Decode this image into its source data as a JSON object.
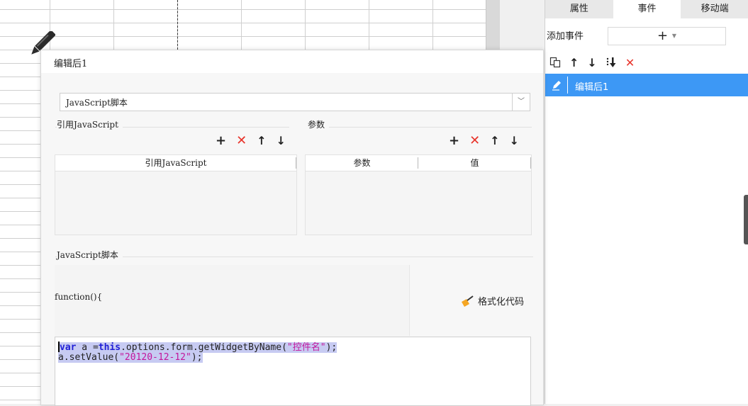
{
  "right_panel": {
    "tabs": [
      "属性",
      "事件",
      "移动端"
    ],
    "active_tab": 1,
    "add_event_label": "添加事件",
    "add_event_button": "+",
    "selected_event": "编辑后1"
  },
  "dialog": {
    "title": "编辑后1",
    "type_select": "JavaScript脚本",
    "ref_js_section": "引用JavaScript",
    "ref_js_column": "引用JavaScript",
    "params_section": "参数",
    "params_columns": [
      "参数",
      "值"
    ],
    "script_section": "JavaScript脚本",
    "function_header": "function(){",
    "format_button": "格式化代码",
    "code": {
      "line1_kw1": "var",
      "line1_mid": " a =",
      "line1_kw2": "this",
      "line1_rest": ".options.form.getWidgetByName(",
      "line1_str": "\"控件名\"",
      "line1_end": ");",
      "line2_start": "a.setValue(",
      "line2_str": "\"20120-12-12\"",
      "line2_end": ");"
    }
  },
  "colors": {
    "accent": "#3d98f5",
    "delete": "#e8332a",
    "keyword": "#1f1fd6",
    "string": "#c3169c",
    "selection": "#c7cbf2"
  },
  "icons": [
    "pencil-icon",
    "copy-icon",
    "arrow-up-icon",
    "arrow-down-icon",
    "move-bottom-icon",
    "delete-icon",
    "edit-icon",
    "broom-icon",
    "chevron-down-icon",
    "plus-icon"
  ]
}
